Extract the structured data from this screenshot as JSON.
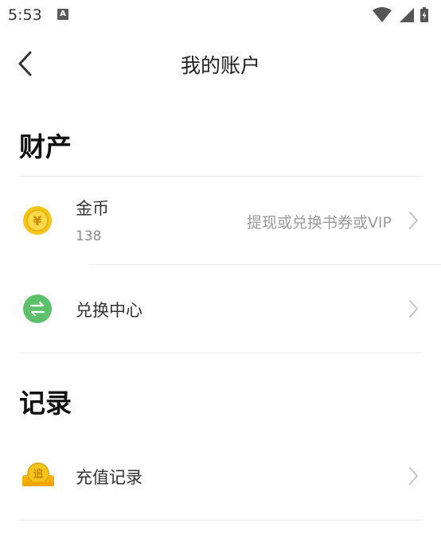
{
  "status": {
    "time": "5:53",
    "notif_letter": "A"
  },
  "header": {
    "title": "我的账户"
  },
  "sections": {
    "assets": "财产",
    "records": "记录"
  },
  "coins": {
    "label": "金币",
    "amount": "138",
    "hint": "提现或兑换书券或VIP",
    "icon_symbol": "¥"
  },
  "exchange": {
    "label": "兑换中心"
  },
  "recharge": {
    "label": "充值记录",
    "icon_symbol": "追"
  },
  "colors": {
    "coin_gold": "#f5c518",
    "exchange_green": "#5cc16a",
    "chevron": "#c4c4c4"
  }
}
